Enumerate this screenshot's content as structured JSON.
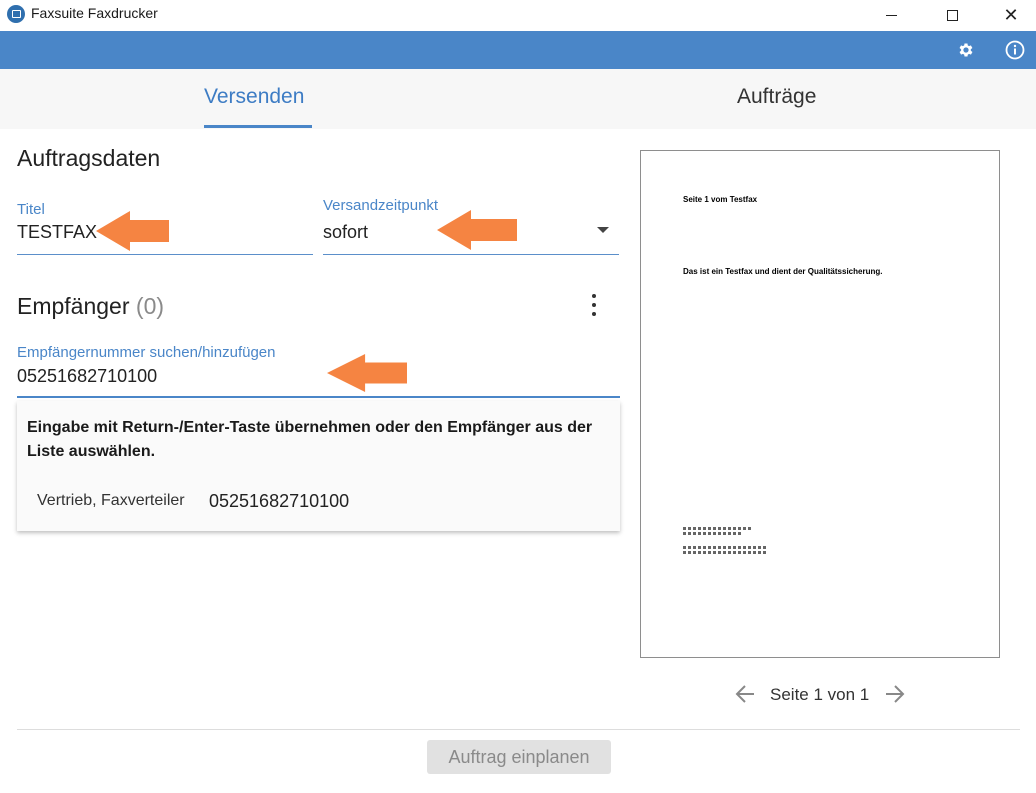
{
  "window": {
    "title": "Faxsuite Faxdrucker",
    "app_icon": "fax-app-icon",
    "controls": [
      "minimize-icon",
      "maximize-icon",
      "close-icon"
    ],
    "close_glyph": "✕"
  },
  "header": {
    "icons": [
      "gear-icon",
      "info-icon"
    ],
    "color": "#4a86c8"
  },
  "tabs": [
    {
      "label": "Versenden",
      "active": true
    },
    {
      "label": "Aufträge",
      "active": false
    }
  ],
  "order": {
    "heading": "Auftragsdaten",
    "title_label": "Titel",
    "title_value": "TESTFAX",
    "time_label": "Versandzeitpunkt",
    "time_value": "sofort"
  },
  "recipients": {
    "heading": "Empfänger",
    "count": "(0)",
    "search_label": "Empfängernummer suchen/hinzufügen",
    "search_value": "05251682710100",
    "hint": "Eingabe mit Return-/Enter-Taste übernehmen oder den Empfänger aus der Liste auswählen.",
    "suggestions": [
      {
        "name": "Vertrieb, Faxverteiler",
        "number": "05251682710100"
      }
    ]
  },
  "preview": {
    "page_heading": "Seite 1 vom Testfax",
    "page_body": "Das ist ein Testfax und dient der Qualitätssicherung.",
    "pager_text": "Seite 1 von 1"
  },
  "actions": {
    "schedule_label": "Auftrag einplanen",
    "schedule_enabled": false
  },
  "colors": {
    "accent": "#4a86c8",
    "annotation_arrow": "#f58442"
  }
}
